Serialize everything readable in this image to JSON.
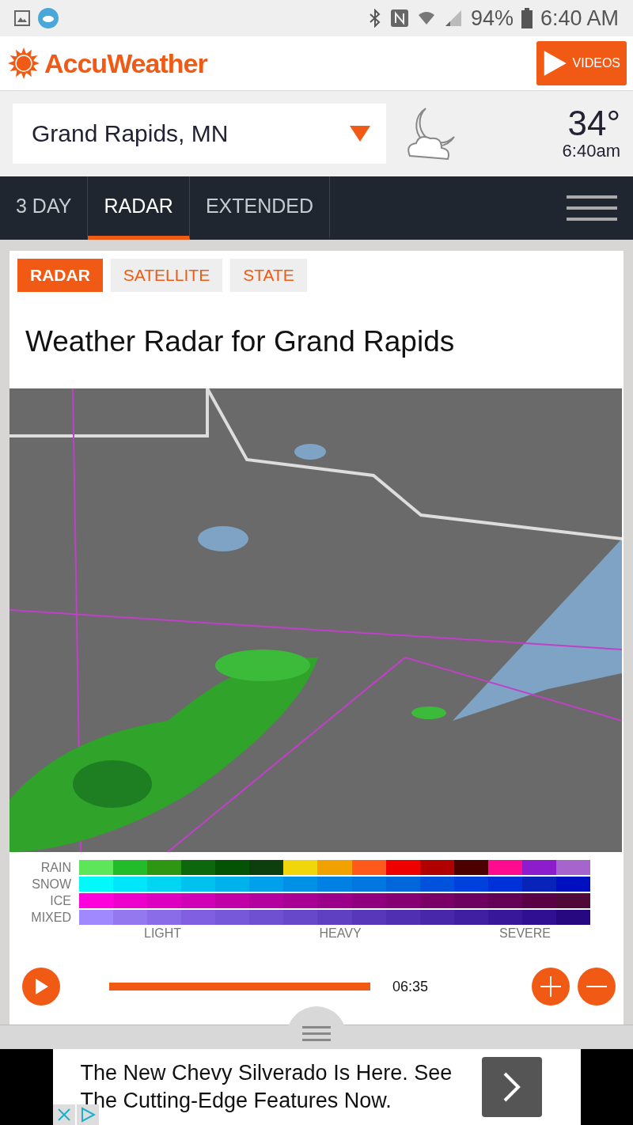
{
  "status_bar": {
    "battery": "94%",
    "time": "6:40 AM"
  },
  "header": {
    "logo": "AccuWeather",
    "videos_button": "VIDEOS"
  },
  "location": {
    "name": "Grand Rapids, MN",
    "temperature": "34°",
    "time": "6:40am"
  },
  "tabs": [
    {
      "label": "3 DAY",
      "selected": false
    },
    {
      "label": "RADAR",
      "selected": true
    },
    {
      "label": "EXTENDED",
      "selected": false
    }
  ],
  "map_tabs": [
    {
      "label": "RADAR",
      "selected": true
    },
    {
      "label": "SATELLITE",
      "selected": false
    },
    {
      "label": "STATE",
      "selected": false
    }
  ],
  "title": "Weather Radar for Grand Rapids",
  "legend": {
    "rows": [
      {
        "label": "RAIN",
        "swatches": [
          {
            "color": "#5ee65a"
          },
          {
            "color": "#22bb2a"
          },
          {
            "color": "#2e9612"
          },
          {
            "color": "#0d680d"
          },
          {
            "color": "#045304"
          },
          {
            "color": "#0c3f0d"
          },
          {
            "color": "#f0d60a"
          },
          {
            "color": "#f2a200"
          },
          {
            "color": "#ff5a1c"
          },
          {
            "color": "#ee0000"
          },
          {
            "color": "#b00000"
          },
          {
            "color": "#4c0000"
          },
          {
            "color": "#ff0b90"
          },
          {
            "color": "#8d1ccc"
          },
          {
            "color": "#a565cc"
          }
        ]
      },
      {
        "label": "SNOW",
        "swatches": [
          {
            "color": "#00fafa"
          },
          {
            "color": "#00e6fa"
          },
          {
            "color": "#00d6f2"
          },
          {
            "color": "#00c2ee"
          },
          {
            "color": "#00b2ec"
          },
          {
            "color": "#00a0ea"
          },
          {
            "color": "#0090e6"
          },
          {
            "color": "#0080e2"
          },
          {
            "color": "#0076e0"
          },
          {
            "color": "#0066dc"
          },
          {
            "color": "#0052dc"
          },
          {
            "color": "#0040dc"
          },
          {
            "color": "#0030d8"
          },
          {
            "color": "#0824b8"
          },
          {
            "color": "#0010c0"
          }
        ]
      },
      {
        "label": "ICE",
        "swatches": [
          {
            "color": "#ff00dc"
          },
          {
            "color": "#ee00cc"
          },
          {
            "color": "#de00c0"
          },
          {
            "color": "#d000b6"
          },
          {
            "color": "#c200a8"
          },
          {
            "color": "#b4009e"
          },
          {
            "color": "#a80094"
          },
          {
            "color": "#9c008a"
          },
          {
            "color": "#90007e"
          },
          {
            "color": "#860074"
          },
          {
            "color": "#7a0068"
          },
          {
            "color": "#6e0060"
          },
          {
            "color": "#640056"
          },
          {
            "color": "#5a0044"
          },
          {
            "color": "#500838"
          }
        ]
      },
      {
        "label": "MIXED",
        "swatches": [
          {
            "color": "#a088ff"
          },
          {
            "color": "#9478f0"
          },
          {
            "color": "#8a6ce8"
          },
          {
            "color": "#8060e0"
          },
          {
            "color": "#7658d8"
          },
          {
            "color": "#6e50d0"
          },
          {
            "color": "#6648c8"
          },
          {
            "color": "#5e40c0"
          },
          {
            "color": "#5838b8"
          },
          {
            "color": "#5030b0"
          },
          {
            "color": "#4828a8"
          },
          {
            "color": "#4020a0"
          },
          {
            "color": "#381898"
          },
          {
            "color": "#301090"
          },
          {
            "color": "#280880"
          }
        ]
      }
    ],
    "scale": [
      "LIGHT",
      "HEAVY",
      "SEVERE"
    ]
  },
  "player": {
    "level": 1,
    "time": "06:35"
  },
  "ad": {
    "text": "The New Chevy Silverado Is Here. See The Cutting-Edge Features Now."
  }
}
